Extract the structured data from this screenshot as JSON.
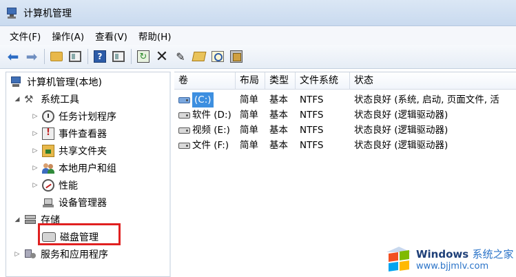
{
  "window": {
    "title": "计算机管理"
  },
  "menu": [
    {
      "label": "文件(F)"
    },
    {
      "label": "操作(A)"
    },
    {
      "label": "查看(V)"
    },
    {
      "label": "帮助(H)"
    }
  ],
  "toolbar": {
    "icons": [
      "back-arrow-icon",
      "forward-arrow-icon",
      "up-folder-icon",
      "show-hide-tree-icon",
      "help-icon",
      "action-pane-icon",
      "refresh-icon",
      "delete-icon",
      "properties-icon",
      "open-icon",
      "search-icon",
      "wizard-icon"
    ]
  },
  "tree": {
    "root": "计算机管理(本地)",
    "system_tools": "系统工具",
    "task_scheduler": "任务计划程序",
    "event_viewer": "事件查看器",
    "shared_folders": "共享文件夹",
    "local_users": "本地用户和组",
    "performance": "性能",
    "device_manager": "设备管理器",
    "storage": "存储",
    "disk_management": "磁盘管理",
    "services_apps": "服务和应用程序"
  },
  "table": {
    "columns": [
      "卷",
      "布局",
      "类型",
      "文件系统",
      "状态"
    ],
    "rows": [
      {
        "volume": "(C:)",
        "layout": "简单",
        "type": "基本",
        "fs": "NTFS",
        "status": "状态良好 (系统, 启动, 页面文件, 活"
      },
      {
        "volume": "软件 (D:)",
        "layout": "简单",
        "type": "基本",
        "fs": "NTFS",
        "status": "状态良好 (逻辑驱动器)"
      },
      {
        "volume": "视频 (E:)",
        "layout": "简单",
        "type": "基本",
        "fs": "NTFS",
        "status": "状态良好 (逻辑驱动器)"
      },
      {
        "volume": "文件 (F:)",
        "layout": "简单",
        "type": "基本",
        "fs": "NTFS",
        "status": "状态良好 (逻辑驱动器)"
      }
    ]
  },
  "watermark": {
    "brand": "Windows",
    "site": "系统之家",
    "url": "www.bjjmlv.com"
  },
  "colors": {
    "highlight_border": "#e02020",
    "system_volume": "#7aa7de"
  }
}
